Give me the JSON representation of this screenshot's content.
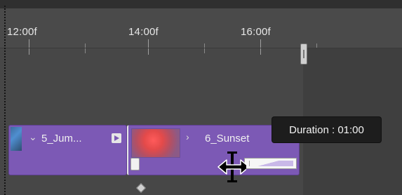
{
  "timeline": {
    "ruler": {
      "labels": [
        "12:00f",
        "14:00f",
        "16:00f"
      ]
    },
    "tracks": [
      {
        "clips": [
          {
            "name": "5_Jum...",
            "color": "#7c59b5"
          },
          {
            "name": "6_Sunset",
            "color": "#7c59b5"
          }
        ]
      }
    ],
    "tooltip": "Duration : 01:00",
    "icons": {
      "clip_disclosure": "chevron-down-icon",
      "sunset_disclosure": "chevron-right-icon",
      "clip_fx_icon": "film-icon",
      "trim_cursor": "trim-resize-cursor-icon",
      "work_area_end": "work-area-end-handle-icon",
      "keyframe": "keyframe-diamond-icon"
    }
  }
}
